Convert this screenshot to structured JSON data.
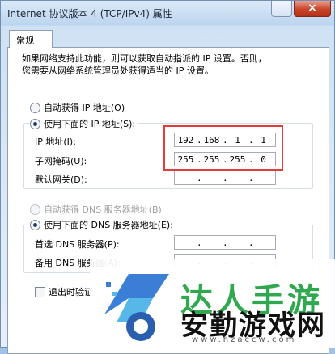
{
  "window": {
    "title": "Internet 协议版本 4 (TCP/IPv4) 属性",
    "close_symbol": "×"
  },
  "tabs": [
    {
      "label": "常规"
    }
  ],
  "intro": {
    "line1": "如果网络支持此功能，则可以获取自动指派的 IP 设置。否则，",
    "line2": "您需要从网络系统管理员处获得适当的 IP 设置。"
  },
  "ip_section": {
    "auto_label": "自动获得 IP 地址(O)",
    "manual_label": "使用下面的 IP 地址(S):",
    "selected": "manual",
    "ip_label": "IP 地址(I):",
    "ip_value": [
      "192",
      "168",
      "1",
      "1"
    ],
    "mask_label": "子网掩码(U):",
    "mask_value": [
      "255",
      "255",
      "255",
      "0"
    ],
    "gateway_label": "默认网关(D):",
    "gateway_value": [
      "",
      "",
      "",
      ""
    ]
  },
  "dns_section": {
    "auto_label": "自动获得 DNS 服务器地址(B)",
    "manual_label": "使用下面的 DNS 服务器地址(E):",
    "selected": "manual",
    "preferred_label": "首选 DNS 服务器(P):",
    "preferred_value": [
      "",
      "",
      "",
      ""
    ],
    "alternate_label": "备用 DNS 服务器(A):",
    "alternate_value": [
      "",
      "",
      "",
      ""
    ]
  },
  "validate_checkbox": {
    "label": "退出时验证",
    "checked": false
  },
  "watermark": {
    "green_text": "达人手游",
    "black_text": "安勤游戏网",
    "url": "www.hzaccw.com"
  },
  "colors": {
    "highlight": "#e23b3b",
    "watermark_green": "#2fa84f"
  }
}
